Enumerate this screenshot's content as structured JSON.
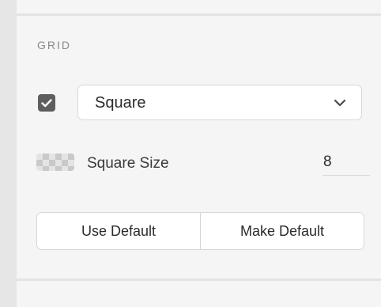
{
  "section": {
    "title": "GRID"
  },
  "grid_toggle": {
    "checked": true
  },
  "grid_type_select": {
    "selected": "Square"
  },
  "square_size": {
    "label": "Square Size",
    "value": "8"
  },
  "buttons": {
    "use_default": "Use Default",
    "make_default": "Make Default"
  },
  "icons": {
    "checkbox": "checkmark-icon",
    "select": "chevron-down-icon",
    "swatch": "checkerboard-swatch-icon"
  },
  "colors": {
    "checkbox_fill": "#5e5e5e",
    "panel_bg": "#f5f5f5"
  }
}
